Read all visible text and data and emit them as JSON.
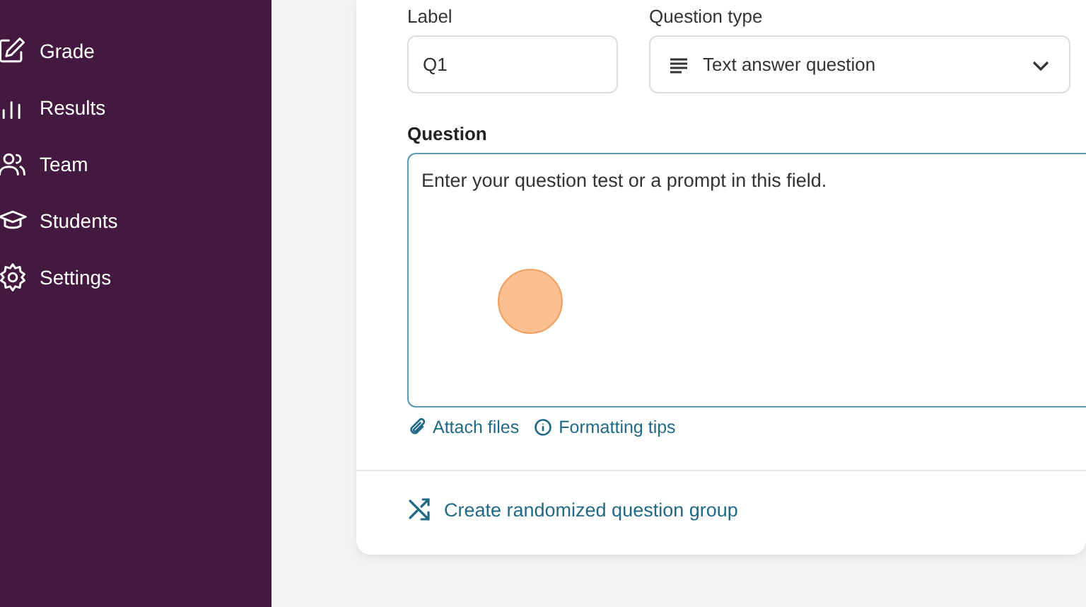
{
  "sidebar": {
    "items": [
      {
        "label": "Grade"
      },
      {
        "label": "Results"
      },
      {
        "label": "Team"
      },
      {
        "label": "Students"
      },
      {
        "label": "Settings"
      }
    ]
  },
  "form": {
    "label_field": {
      "label": "Label",
      "value": "Q1"
    },
    "type_field": {
      "label": "Question type",
      "value": "Text answer question"
    },
    "question_field": {
      "label": "Question",
      "value": "Enter your question test or a prompt in this field."
    },
    "links": [
      "Attach files",
      "Formatting tips"
    ],
    "group_link": "Create randomized question group"
  }
}
